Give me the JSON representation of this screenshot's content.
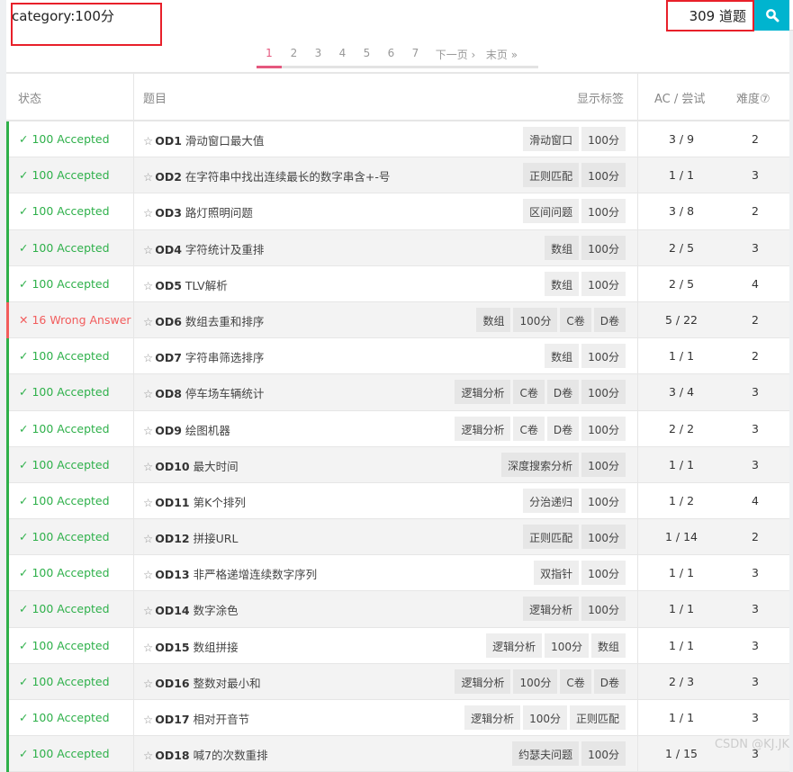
{
  "search": {
    "value": "category:100分",
    "count": "309 道题"
  },
  "pagination": {
    "pages": [
      "1",
      "2",
      "3",
      "4",
      "5",
      "6",
      "7"
    ],
    "next": "下一页 ›",
    "last": "末页 »",
    "current": "1"
  },
  "header": {
    "status": "状态",
    "title": "题目",
    "tags": "显示标签",
    "ac": "AC / 尝试",
    "difficulty": "难度⑦"
  },
  "colors": {
    "accepted": "#2eb04a",
    "wrong": "#f25c5c",
    "accent": "#00b4cf"
  },
  "rows": [
    {
      "status": "100 Accepted",
      "ok": true,
      "id": "OD1",
      "name": "滑动窗口最大值",
      "tags": [
        "滑动窗口",
        "100分"
      ],
      "ac": "3 / 9",
      "diff": "2"
    },
    {
      "status": "100 Accepted",
      "ok": true,
      "id": "OD2",
      "name": "在字符串中找出连续最长的数字串含+-号",
      "tags": [
        "正则匹配",
        "100分"
      ],
      "ac": "1 / 1",
      "diff": "3"
    },
    {
      "status": "100 Accepted",
      "ok": true,
      "id": "OD3",
      "name": "路灯照明问题",
      "tags": [
        "区间问题",
        "100分"
      ],
      "ac": "3 / 8",
      "diff": "2"
    },
    {
      "status": "100 Accepted",
      "ok": true,
      "id": "OD4",
      "name": "字符统计及重排",
      "tags": [
        "数组",
        "100分"
      ],
      "ac": "2 / 5",
      "diff": "3"
    },
    {
      "status": "100 Accepted",
      "ok": true,
      "id": "OD5",
      "name": "TLV解析",
      "tags": [
        "数组",
        "100分"
      ],
      "ac": "2 / 5",
      "diff": "4"
    },
    {
      "status": "16 Wrong Answer",
      "ok": false,
      "id": "OD6",
      "name": "数组去重和排序",
      "tags": [
        "数组",
        "100分",
        "C卷",
        "D卷"
      ],
      "ac": "5 / 22",
      "diff": "2"
    },
    {
      "status": "100 Accepted",
      "ok": true,
      "id": "OD7",
      "name": "字符串筛选排序",
      "tags": [
        "数组",
        "100分"
      ],
      "ac": "1 / 1",
      "diff": "2"
    },
    {
      "status": "100 Accepted",
      "ok": true,
      "id": "OD8",
      "name": "停车场车辆统计",
      "tags": [
        "逻辑分析",
        "C卷",
        "D卷",
        "100分"
      ],
      "ac": "3 / 4",
      "diff": "3"
    },
    {
      "status": "100 Accepted",
      "ok": true,
      "id": "OD9",
      "name": "绘图机器",
      "tags": [
        "逻辑分析",
        "C卷",
        "D卷",
        "100分"
      ],
      "ac": "2 / 2",
      "diff": "3"
    },
    {
      "status": "100 Accepted",
      "ok": true,
      "id": "OD10",
      "name": "最大时间",
      "tags": [
        "深度搜索分析",
        "100分"
      ],
      "ac": "1 / 1",
      "diff": "3"
    },
    {
      "status": "100 Accepted",
      "ok": true,
      "id": "OD11",
      "name": "第K个排列",
      "tags": [
        "分治递归",
        "100分"
      ],
      "ac": "1 / 2",
      "diff": "4"
    },
    {
      "status": "100 Accepted",
      "ok": true,
      "id": "OD12",
      "name": "拼接URL",
      "tags": [
        "正则匹配",
        "100分"
      ],
      "ac": "1 / 14",
      "diff": "2"
    },
    {
      "status": "100 Accepted",
      "ok": true,
      "id": "OD13",
      "name": "非严格递增连续数字序列",
      "tags": [
        "双指针",
        "100分"
      ],
      "ac": "1 / 1",
      "diff": "3"
    },
    {
      "status": "100 Accepted",
      "ok": true,
      "id": "OD14",
      "name": "数字涂色",
      "tags": [
        "逻辑分析",
        "100分"
      ],
      "ac": "1 / 1",
      "diff": "3"
    },
    {
      "status": "100 Accepted",
      "ok": true,
      "id": "OD15",
      "name": "数组拼接",
      "tags": [
        "逻辑分析",
        "100分",
        "数组"
      ],
      "ac": "1 / 1",
      "diff": "3"
    },
    {
      "status": "100 Accepted",
      "ok": true,
      "id": "OD16",
      "name": "整数对最小和",
      "tags": [
        "逻辑分析",
        "100分",
        "C卷",
        "D卷"
      ],
      "ac": "2 / 3",
      "diff": "3"
    },
    {
      "status": "100 Accepted",
      "ok": true,
      "id": "OD17",
      "name": "相对开音节",
      "tags": [
        "逻辑分析",
        "100分",
        "正则匹配"
      ],
      "ac": "1 / 1",
      "diff": "3"
    },
    {
      "status": "100 Accepted",
      "ok": true,
      "id": "OD18",
      "name": "喊7的次数重排",
      "tags": [
        "约瑟夫问题",
        "100分"
      ],
      "ac": "1 / 15",
      "diff": "3"
    }
  ],
  "watermark": "CSDN @KJ.JK"
}
